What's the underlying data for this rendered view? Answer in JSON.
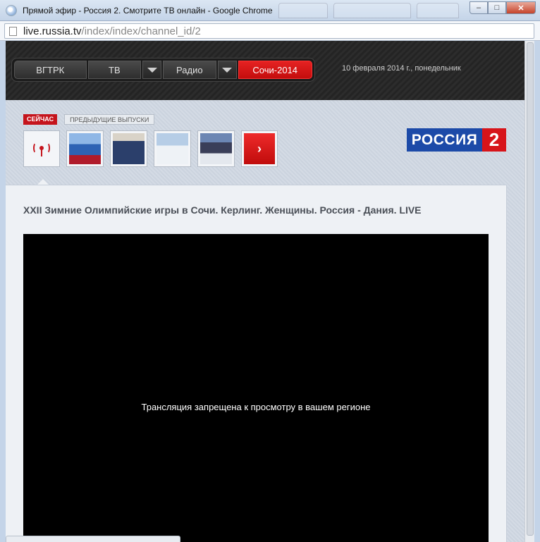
{
  "window": {
    "title": "Прямой эфир - Россия 2. Смотрите ТВ онлайн - Google Chrome",
    "buttons": {
      "minimize": "–",
      "maximize": "□",
      "close": "✕"
    }
  },
  "address": {
    "host": "live.russia.tv",
    "path": "/index/index/channel_id/2"
  },
  "nav": {
    "items": [
      {
        "label": "ВГТРК"
      },
      {
        "label": "ТВ"
      },
      {
        "label": "Радио"
      },
      {
        "label": "Сочи-2014"
      }
    ],
    "date": "10 февраля 2014 г., понедельник"
  },
  "tabs": {
    "now": "СЕЙЧАС",
    "previous": "ПРЕДЫДУЩИЕ ВЫПУСКИ"
  },
  "logo": {
    "word": "РОССИЯ",
    "number": "2"
  },
  "next_arrow": "›",
  "headline": "XXII Зимние Олимпийские игры в Сочи. Керлинг. Женщины. Россия - Дания. LIVE",
  "player": {
    "message": "Трансляция запрещена к просмотру в вашем регионе"
  },
  "colors": {
    "accent": "#c5141c",
    "logo_blue": "#1c4aa8",
    "header_bg": "#2a2a2a"
  }
}
